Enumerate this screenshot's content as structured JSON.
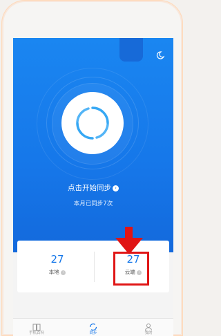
{
  "colors": {
    "accent": "#1677e9",
    "highlight": "#e01515"
  },
  "hero": {
    "start_label": "点击开始同步",
    "month_label": "本月已同步7次"
  },
  "stats": {
    "local": {
      "value": "27",
      "label": "本地"
    },
    "cloud": {
      "value": "27",
      "label": "云端"
    }
  },
  "tabbar": {
    "items": [
      {
        "label": "手机百科",
        "icon": "book-icon"
      },
      {
        "label": "同步",
        "icon": "sync-icon"
      },
      {
        "label": "我的",
        "icon": "user-icon"
      }
    ]
  }
}
